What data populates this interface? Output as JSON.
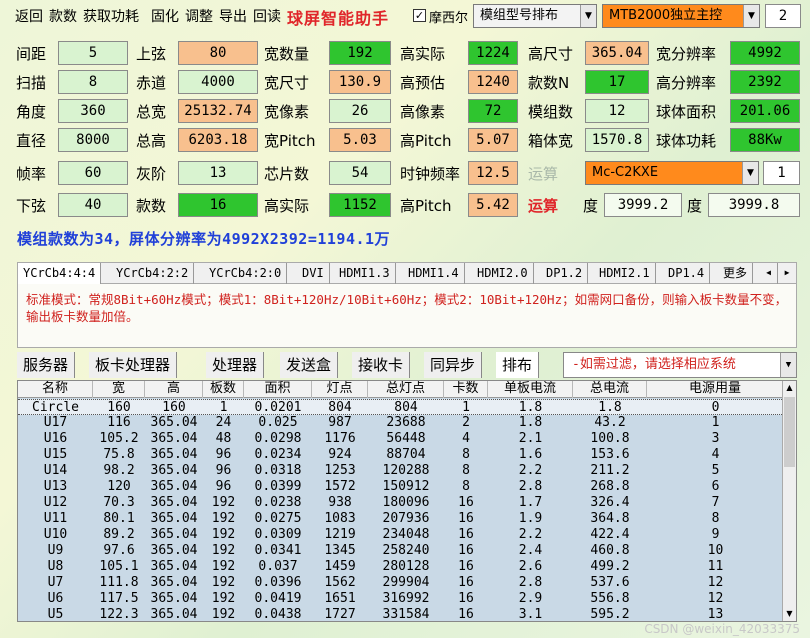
{
  "menu": [
    "返回",
    "款数",
    "获取功耗",
    "固化",
    "调整",
    "导出",
    "回读"
  ],
  "app_title": "球屏智能助手",
  "checkbox": {
    "label": "摩西尔",
    "checked": "✓"
  },
  "combo_model": "模组型号排布",
  "combo_controller": "MTB2000独立主控",
  "controller_count": "2",
  "fields": {
    "r1": {
      "l1": "间距",
      "v1": "5",
      "l2": "上弦",
      "v2": "80",
      "l3": "宽数量",
      "v3": "192",
      "l4": "高实际",
      "v4": "1224",
      "l5": "高尺寸",
      "v5": "365.04",
      "l6": "宽分辨率",
      "v6": "4992"
    },
    "r2": {
      "l1": "扫描",
      "v1": "8",
      "l2": "赤道",
      "v2": "4000",
      "l3": "宽尺寸",
      "v3": "130.9",
      "l4": "高预估",
      "v4": "1240",
      "l5": "款数N",
      "v5": "17",
      "l6": "高分辨率",
      "v6": "2392"
    },
    "r3": {
      "l1": "角度",
      "v1": "360",
      "l2": "总宽",
      "v2": "25132.74",
      "l3": "宽像素",
      "v3": "26",
      "l4": "高像素",
      "v4": "72",
      "l5": "模组数",
      "v5": "12",
      "l6": "球体面积",
      "v6": "201.06"
    },
    "r4": {
      "l1": "直径",
      "v1": "8000",
      "l2": "总高",
      "v2": "6203.18",
      "l3": "宽Pitch",
      "v3": "5.03",
      "l4": "高Pitch",
      "v4": "5.07",
      "l5": "箱体宽",
      "v5": "1570.8",
      "l6": "球体功耗",
      "v6": "88Kw"
    },
    "r5": {
      "l1": "帧率",
      "v1": "60",
      "l2": "灰阶",
      "v2": "13",
      "l3": "芯片数",
      "v3": "54",
      "l4": "时钟频率",
      "v4": "12.5",
      "l5": "运算",
      "v5": "Mc-C2KXE",
      "v6": "1"
    },
    "r6": {
      "l1": "下弦",
      "v1": "40",
      "l2": "款数",
      "v2": "16",
      "l3": "高实际",
      "v3": "1152",
      "l4": "高Pitch",
      "v4": "5.42",
      "l5": "运算",
      "l6": "度",
      "v6": "3999.2",
      "l7": "度",
      "v7": "3999.8"
    }
  },
  "summary": "模组款数为34，屏体分辨率为4992X2392=1194.1万",
  "tabs": [
    "YCrCb4:4:4",
    "YCrCb4:2:2",
    "YCrCb4:2:0",
    "DVI",
    "HDMI1.3",
    "HDMI1.4",
    "HDMI2.0",
    "DP1.2",
    "HDMI2.1",
    "DP1.4",
    "更多"
  ],
  "tab_note": "标准模式：常规8Bit+60Hz模式；模式1：8Bit+120Hz/10Bit+60Hz；模式2：10Bit+120Hz；如需网口备份，则输入板卡数量不变，输出板卡数量加倍。",
  "sys_tabs": [
    "服务器",
    "板卡处理器",
    "处理器",
    "发送盒",
    "接收卡",
    "同异步",
    "排布"
  ],
  "filter_text": "-如需过滤，请选择相应系统",
  "columns": [
    "名称",
    "宽",
    "高",
    "板数",
    "面积",
    "灯点",
    "总灯点",
    "卡数",
    "单板电流",
    "总电流",
    "电源用量"
  ],
  "rows": [
    [
      "Circle",
      "160",
      "160",
      "1",
      "0.0201",
      "804",
      "804",
      "1",
      "1.8",
      "1.8",
      "0"
    ],
    [
      "U17",
      "116",
      "365.04",
      "24",
      "0.025",
      "987",
      "23688",
      "2",
      "1.8",
      "43.2",
      "1"
    ],
    [
      "U16",
      "105.2",
      "365.04",
      "48",
      "0.0298",
      "1176",
      "56448",
      "4",
      "2.1",
      "100.8",
      "3"
    ],
    [
      "U15",
      "75.8",
      "365.04",
      "96",
      "0.0234",
      "924",
      "88704",
      "8",
      "1.6",
      "153.6",
      "4"
    ],
    [
      "U14",
      "98.2",
      "365.04",
      "96",
      "0.0318",
      "1253",
      "120288",
      "8",
      "2.2",
      "211.2",
      "5"
    ],
    [
      "U13",
      "120",
      "365.04",
      "96",
      "0.0399",
      "1572",
      "150912",
      "8",
      "2.8",
      "268.8",
      "6"
    ],
    [
      "U12",
      "70.3",
      "365.04",
      "192",
      "0.0238",
      "938",
      "180096",
      "16",
      "1.7",
      "326.4",
      "7"
    ],
    [
      "U11",
      "80.1",
      "365.04",
      "192",
      "0.0275",
      "1083",
      "207936",
      "16",
      "1.9",
      "364.8",
      "8"
    ],
    [
      "U10",
      "89.2",
      "365.04",
      "192",
      "0.0309",
      "1219",
      "234048",
      "16",
      "2.2",
      "422.4",
      "9"
    ],
    [
      "U9",
      "97.6",
      "365.04",
      "192",
      "0.0341",
      "1345",
      "258240",
      "16",
      "2.4",
      "460.8",
      "10"
    ],
    [
      "U8",
      "105.1",
      "365.04",
      "192",
      "0.037",
      "1459",
      "280128",
      "16",
      "2.6",
      "499.2",
      "11"
    ],
    [
      "U7",
      "111.8",
      "365.04",
      "192",
      "0.0396",
      "1562",
      "299904",
      "16",
      "2.8",
      "537.6",
      "12"
    ],
    [
      "U6",
      "117.5",
      "365.04",
      "192",
      "0.0419",
      "1651",
      "316992",
      "16",
      "2.9",
      "556.8",
      "12"
    ],
    [
      "U5",
      "122.3",
      "365.04",
      "192",
      "0.0438",
      "1727",
      "331584",
      "16",
      "3.1",
      "595.2",
      "13"
    ]
  ],
  "watermark": "CSDN @weixin_42033375",
  "colors": {
    "title": "#e0262a",
    "summary": "#2040d8",
    "orange_combo": "#ff8a1c",
    "green": "#2fc52f",
    "peach": "#f8c08e",
    "pale_green": "#d9f3d0",
    "grid_bg": "#c9d9e6",
    "note_red": "#d0221e"
  }
}
